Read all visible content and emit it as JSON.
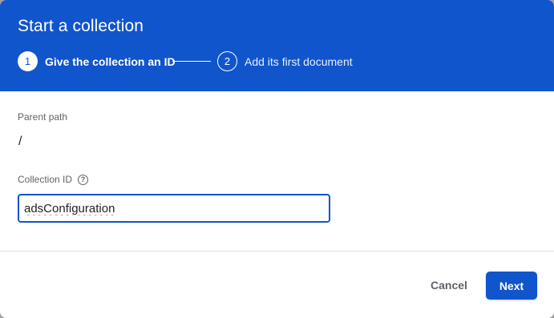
{
  "dialog": {
    "title": "Start a collection"
  },
  "stepper": {
    "steps": [
      {
        "number": "1",
        "label": "Give the collection an ID",
        "state": "active"
      },
      {
        "number": "2",
        "label": "Add its first document",
        "state": "inactive"
      }
    ]
  },
  "form": {
    "parent_path_label": "Parent path",
    "parent_path_value": "/",
    "collection_id_label": "Collection ID",
    "help_icon_glyph": "?",
    "collection_id_value": "adsConfiguration"
  },
  "actions": {
    "cancel_label": "Cancel",
    "next_label": "Next"
  },
  "colors": {
    "primary": "#1155cc",
    "header_text": "#ffffff",
    "muted_text": "#5f6368",
    "spellcheck_underline": "#d93025"
  },
  "icons": {
    "help": "help-circle-icon"
  }
}
